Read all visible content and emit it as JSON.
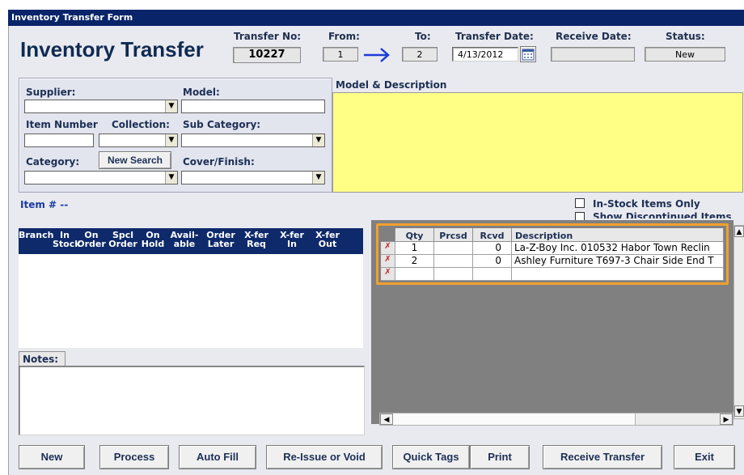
{
  "window": {
    "title": "Inventory Transfer Form"
  },
  "header": {
    "title": "Inventory Transfer",
    "transfer_no_label": "Transfer No:",
    "transfer_no": "10227",
    "from_label": "From:",
    "from": "1",
    "to_label": "To:",
    "to": "2",
    "transfer_date_label": "Transfer Date:",
    "transfer_date": "4/13/2012",
    "receive_date_label": "Receive Date:",
    "receive_date": "",
    "status_label": "Status:",
    "status": "New"
  },
  "search": {
    "supplier_label": "Supplier:",
    "model_label": "Model:",
    "item_number_label": "Item Number",
    "collection_label": "Collection:",
    "sub_category_label": "Sub Category:",
    "category_label": "Category:",
    "new_search_label": "New Search",
    "cover_finish_label": "Cover/Finish:"
  },
  "model_description": {
    "label": "Model & Description"
  },
  "options": {
    "in_stock_only": "In-Stock Items Only",
    "show_discontinued": "Show Discontinued Items"
  },
  "item": {
    "label": "Item #",
    "value": "--"
  },
  "stock_table": {
    "columns": [
      [
        "",
        "Branch"
      ],
      [
        "In",
        "Stock"
      ],
      [
        "On",
        "Order"
      ],
      [
        "Spcl",
        "Order"
      ],
      [
        "On",
        "Hold"
      ],
      [
        "Avail-",
        "able"
      ],
      [
        "Order",
        "Later"
      ],
      [
        "X-fer",
        "Req"
      ],
      [
        "X-fer",
        "In"
      ],
      [
        "X-fer",
        "Out"
      ]
    ]
  },
  "notes": {
    "label": "Notes:"
  },
  "transfer_grid": {
    "columns": [
      "Qty",
      "Prcsd",
      "Rcvd",
      "Description"
    ],
    "rows": [
      {
        "qty": "1",
        "prcsd": "",
        "rcvd": "0",
        "description": "La-Z-Boy Inc. 010532 Habor Town Reclin"
      },
      {
        "qty": "2",
        "prcsd": "",
        "rcvd": "0",
        "description": "Ashley Furniture T697-3 Chair Side End T"
      },
      {
        "qty": "",
        "prcsd": "",
        "rcvd": "",
        "description": ""
      }
    ],
    "highlight_color": "#f0a030"
  },
  "buttons": {
    "new": "New",
    "process": "Process",
    "auto_fill": "Auto Fill",
    "reissue_void": "Re-Issue or Void",
    "quick_tags": "Quick Tags",
    "print": "Print",
    "receive_transfer": "Receive Transfer",
    "exit": "Exit"
  },
  "icons": {
    "calendar": "calendar-icon",
    "arrow": "right-arrow-icon",
    "row_delete": "delete-row-icon"
  },
  "colors": {
    "title_bar": "#0a246a",
    "form_bg": "#e9eaf0",
    "model_panel": "#ffff85",
    "stock_header": "#0f2a6a",
    "grid_bg": "#808080"
  }
}
